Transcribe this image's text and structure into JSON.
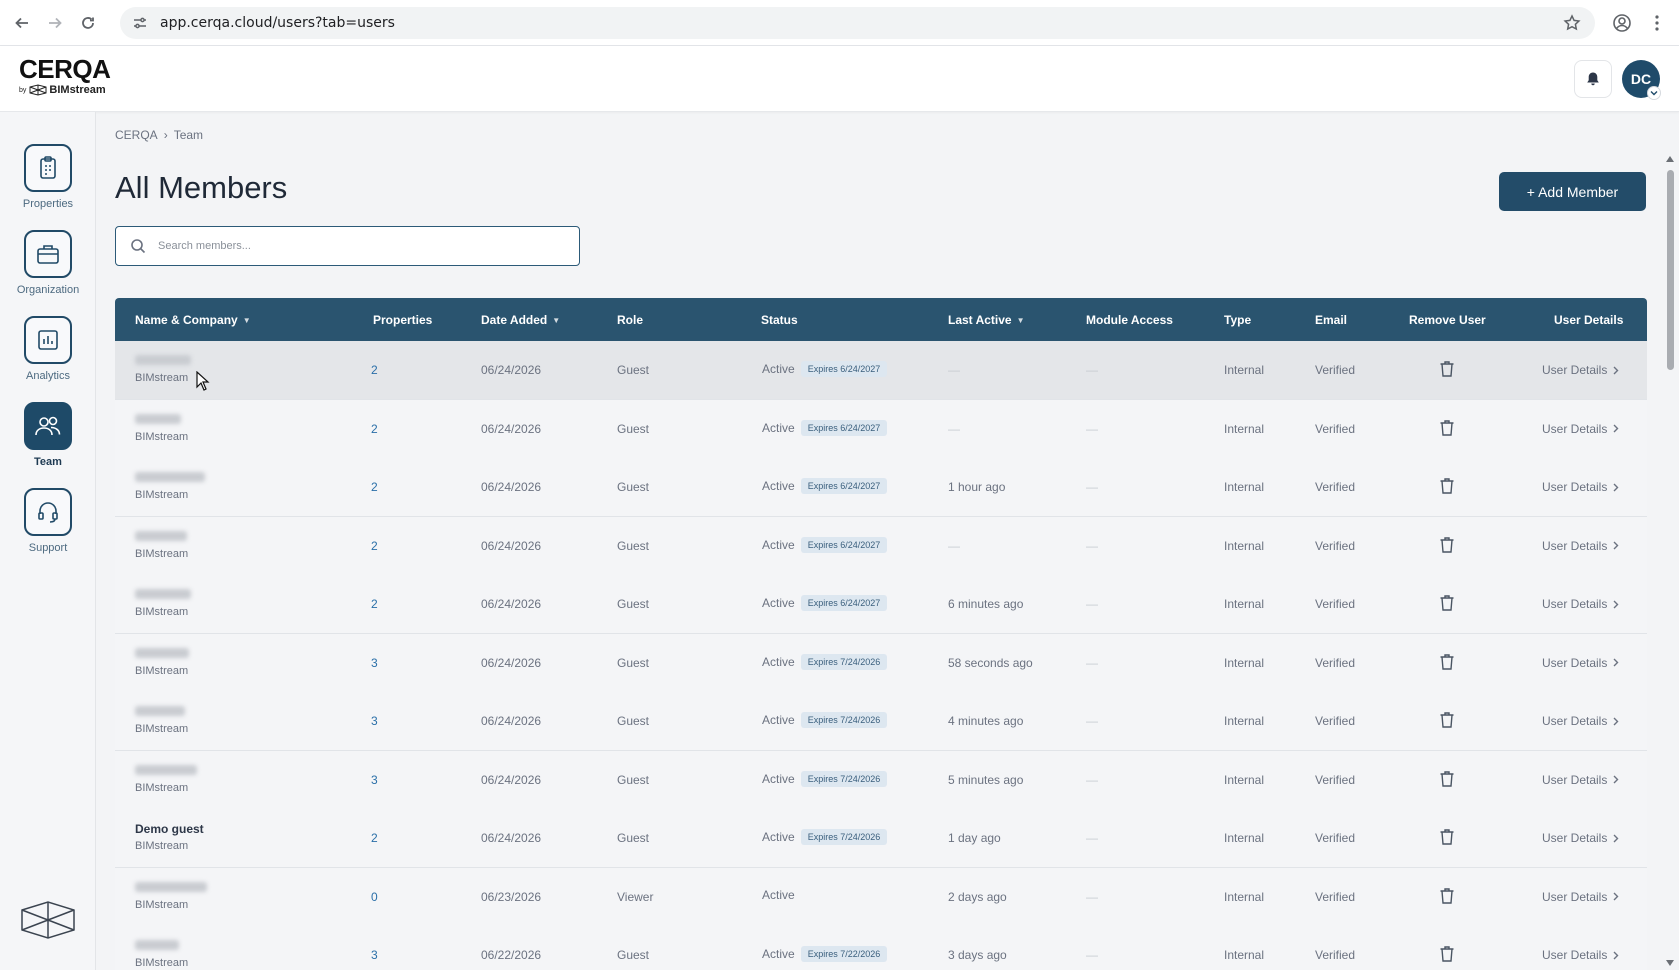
{
  "browser": {
    "url": "app.cerqa.cloud/users?tab=users"
  },
  "header": {
    "logo_main": "CERQA",
    "logo_by": "by",
    "logo_brand": "BIMstream",
    "avatar_initials": "DC"
  },
  "sidebar": {
    "items": [
      {
        "label": "Properties",
        "icon": "clipboard-icon",
        "active": false
      },
      {
        "label": "Organization",
        "icon": "briefcase-icon",
        "active": false
      },
      {
        "label": "Analytics",
        "icon": "chart-icon",
        "active": false
      },
      {
        "label": "Team",
        "icon": "people-icon",
        "active": true
      },
      {
        "label": "Support",
        "icon": "headset-icon",
        "active": false
      }
    ]
  },
  "breadcrumb": {
    "root": "CERQA",
    "separator": "›",
    "current": "Team"
  },
  "page": {
    "title": "All Members",
    "add_button": "+ Add Member",
    "search_placeholder": "Search members..."
  },
  "table": {
    "columns": {
      "name": "Name & Company",
      "properties": "Properties",
      "date_added": "Date Added",
      "role": "Role",
      "status": "Status",
      "last_active": "Last Active",
      "module_access": "Module Access",
      "type": "Type",
      "email": "Email",
      "remove": "Remove User",
      "details": "User Details"
    },
    "rows": [
      {
        "name": "",
        "company": "BIMstream",
        "properties": "2",
        "date": "06/24/2026",
        "role": "Guest",
        "status": "Active",
        "expires": "Expires 6/24/2027",
        "last_active": "—",
        "module": "—",
        "type": "Internal",
        "email": "Verified",
        "details": "User Details"
      },
      {
        "name": "",
        "company": "BIMstream",
        "properties": "2",
        "date": "06/24/2026",
        "role": "Guest",
        "status": "Active",
        "expires": "Expires 6/24/2027",
        "last_active": "—",
        "module": "—",
        "type": "Internal",
        "email": "Verified",
        "details": "User Details"
      },
      {
        "name": "",
        "company": "BIMstream",
        "properties": "2",
        "date": "06/24/2026",
        "role": "Guest",
        "status": "Active",
        "expires": "Expires 6/24/2027",
        "last_active": "1 hour ago",
        "module": "—",
        "type": "Internal",
        "email": "Verified",
        "details": "User Details"
      },
      {
        "name": "",
        "company": "BIMstream",
        "properties": "2",
        "date": "06/24/2026",
        "role": "Guest",
        "status": "Active",
        "expires": "Expires 6/24/2027",
        "last_active": "—",
        "module": "—",
        "type": "Internal",
        "email": "Verified",
        "details": "User Details"
      },
      {
        "name": "",
        "company": "BIMstream",
        "properties": "2",
        "date": "06/24/2026",
        "role": "Guest",
        "status": "Active",
        "expires": "Expires 6/24/2027",
        "last_active": "6 minutes ago",
        "module": "—",
        "type": "Internal",
        "email": "Verified",
        "details": "User Details"
      },
      {
        "name": "",
        "company": "BIMstream",
        "properties": "3",
        "date": "06/24/2026",
        "role": "Guest",
        "status": "Active",
        "expires": "Expires 7/24/2026",
        "last_active": "58 seconds ago",
        "module": "—",
        "type": "Internal",
        "email": "Verified",
        "details": "User Details"
      },
      {
        "name": "",
        "company": "BIMstream",
        "properties": "3",
        "date": "06/24/2026",
        "role": "Guest",
        "status": "Active",
        "expires": "Expires 7/24/2026",
        "last_active": "4 minutes ago",
        "module": "—",
        "type": "Internal",
        "email": "Verified",
        "details": "User Details"
      },
      {
        "name": "",
        "company": "BIMstream",
        "properties": "3",
        "date": "06/24/2026",
        "role": "Guest",
        "status": "Active",
        "expires": "Expires 7/24/2026",
        "last_active": "5 minutes ago",
        "module": "—",
        "type": "Internal",
        "email": "Verified",
        "details": "User Details"
      },
      {
        "name": "Demo guest",
        "company": "BIMstream",
        "properties": "2",
        "date": "06/24/2026",
        "role": "Guest",
        "status": "Active",
        "expires": "Expires 7/24/2026",
        "last_active": "1 day ago",
        "module": "—",
        "type": "Internal",
        "email": "Verified",
        "details": "User Details"
      },
      {
        "name": "",
        "company": "BIMstream",
        "properties": "0",
        "date": "06/23/2026",
        "role": "Viewer",
        "status": "Active",
        "expires": "",
        "last_active": "2 days ago",
        "module": "—",
        "type": "Internal",
        "email": "Verified",
        "details": "User Details"
      },
      {
        "name": "",
        "company": "BIMstream",
        "properties": "3",
        "date": "06/22/2026",
        "role": "Guest",
        "status": "Active",
        "expires": "Expires 7/22/2026",
        "last_active": "3 days ago",
        "module": "—",
        "type": "Internal",
        "email": "Verified",
        "details": "User Details"
      }
    ]
  },
  "colors": {
    "primary": "#234c69",
    "table_header": "#2a546f",
    "link": "#2a6fa8",
    "expires_bg": "#dde7f0"
  }
}
